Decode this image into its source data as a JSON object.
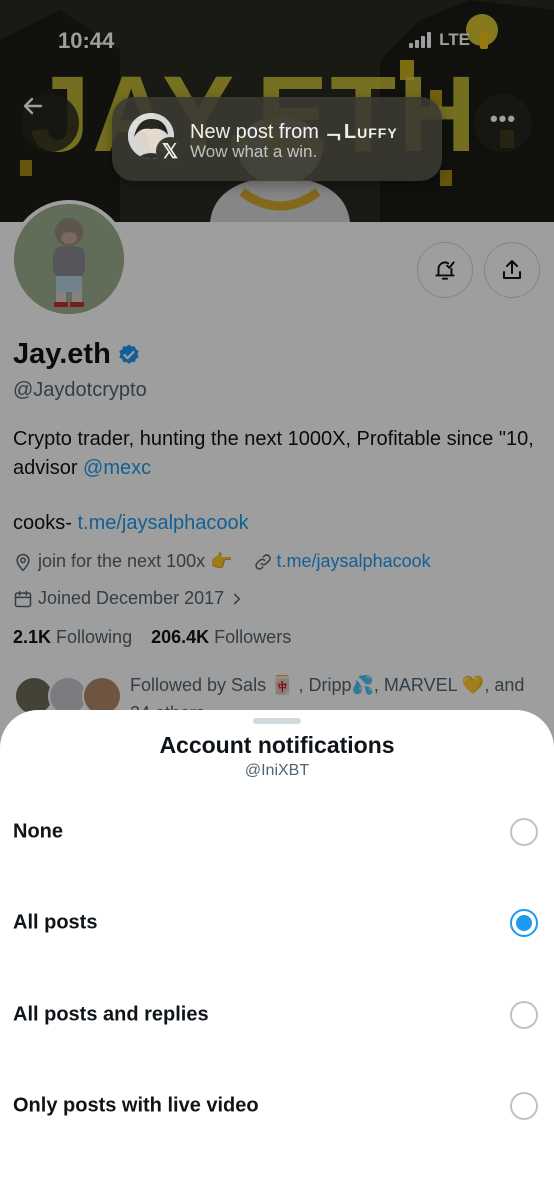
{
  "status_bar": {
    "time": "10:44",
    "network": "LTE"
  },
  "banner": {
    "title_text": "JAY.ETH"
  },
  "toast": {
    "title_prefix": "New post from",
    "title_name": "ᆨLuffy",
    "message": "Wow what a win.",
    "badge": "𝕏"
  },
  "profile": {
    "name": "Jay.eth",
    "handle": "@Jaydotcrypto",
    "bio_text": "Crypto trader, hunting the next 1000X, Profitable since \"10, advisor ",
    "bio_mention": "@mexc",
    "cooks_prefix": "cooks- ",
    "cooks_link": "t.me/jaysalphacook",
    "location": "join for the next 100x 👉",
    "website": "t.me/jaysalphacook",
    "joined": "Joined December 2017",
    "following_count": "2.1K",
    "following_label": "Following",
    "followers_count": "206.4K",
    "followers_label": "Followers",
    "followed_by": "Followed by Sals 🀄 , Dripp💦, MARVEL 💛, and 24 others"
  },
  "sheet": {
    "title": "Account notifications",
    "subtitle": "@IniXBT",
    "options": [
      {
        "label": "None",
        "selected": false
      },
      {
        "label": "All posts",
        "selected": true
      },
      {
        "label": "All posts and replies",
        "selected": false
      },
      {
        "label": "Only posts with live video",
        "selected": false
      }
    ]
  },
  "colors": {
    "accent": "#1d9bf0",
    "verified": "#1d9bf0",
    "text": "#0f1419",
    "muted": "#536471"
  },
  "icons": [
    "back-arrow-icon",
    "more-icon",
    "x-logo-icon",
    "notification-bell-icon",
    "share-icon",
    "verified-badge-icon",
    "location-icon",
    "link-icon",
    "calendar-icon",
    "chevron-right-icon"
  ]
}
